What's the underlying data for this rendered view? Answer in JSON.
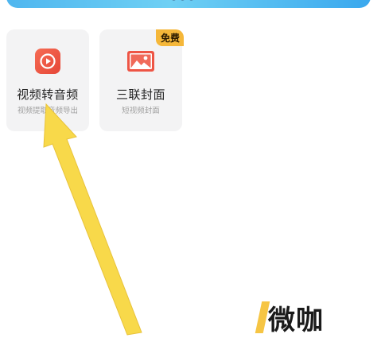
{
  "tools": [
    {
      "title": "视频转音频",
      "subtitle": "视频提取音频导出",
      "icon": "video-play-icon",
      "icon_color": "#f0533f"
    },
    {
      "title": "三联封面",
      "subtitle": "短视频封面",
      "icon": "image-icon",
      "icon_color": "#ee5545",
      "badge": "免费",
      "badge_color": "#f5b739"
    }
  ],
  "annotation": {
    "arrow_color": "#f8d94a"
  },
  "watermark": {
    "text": "微咖",
    "accent_color": "#f6c544"
  }
}
